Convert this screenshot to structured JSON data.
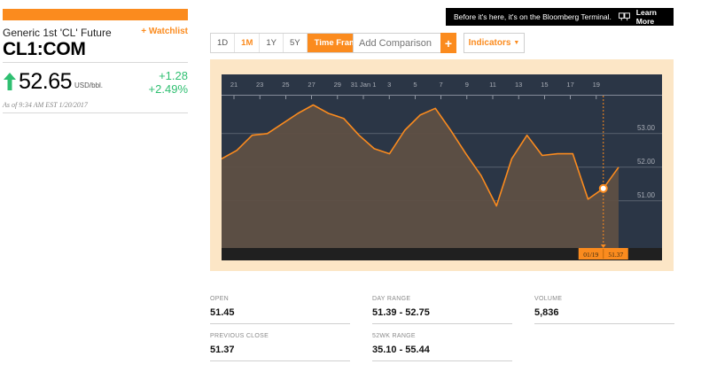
{
  "quote": {
    "name": "Generic 1st 'CL' Future",
    "watchlist_label": "+ Watchlist",
    "ticker": "CL1:COM",
    "price": "52.65",
    "unit": "USD/bbl.",
    "change": "+1.28",
    "change_pct": "+2.49%",
    "as_of": "As of 9:34 AM EST 1/20/2017",
    "direction_icon": "up-arrow-icon",
    "up_color": "#2fbf71",
    "accent_color": "#fb8b1e"
  },
  "ad": {
    "message": "Before it's here, it's on the Bloomberg Terminal.",
    "icon": "terminal-icon",
    "cta": "Learn More"
  },
  "toolbar": {
    "ranges": [
      "1D",
      "1M",
      "1Y",
      "5Y"
    ],
    "active_range": "1M",
    "time_frame_label": "Time Frame",
    "comparison_placeholder": "Add Comparison",
    "add_label": "+",
    "indicators_label": "Indicators"
  },
  "chart_data": {
    "type": "area",
    "x_ticks": [
      "21",
      "23",
      "25",
      "27",
      "29",
      "31 Jan 1",
      "3",
      "5",
      "7",
      "9",
      "11",
      "13",
      "15",
      "17",
      "19"
    ],
    "y_ticks": [
      "53.00",
      "52.00",
      "51.00"
    ],
    "ylim": [
      49.6,
      54.1
    ],
    "series": [
      {
        "values": [
          52.25,
          52.5,
          52.95,
          53.0,
          53.3,
          53.6,
          53.85,
          53.6,
          53.45,
          52.95,
          52.55,
          52.4,
          53.1,
          53.55,
          53.75,
          53.1,
          52.4,
          51.75,
          50.85,
          52.25,
          52.95,
          52.35,
          52.4,
          52.4,
          51.05,
          51.37,
          52.0
        ]
      }
    ],
    "crosshair": {
      "date_label": "01/19",
      "value_label": "51.37",
      "value": 51.37
    },
    "colors": {
      "background": "#2b3646",
      "line": "#fb8b1e",
      "area": "#5e5044",
      "grid": "#aab0bb",
      "axis_text": "#a8adb6"
    }
  },
  "stats": {
    "open": {
      "label": "OPEN",
      "value": "51.45"
    },
    "day_range": {
      "label": "DAY RANGE",
      "value": "51.39 - 52.75"
    },
    "volume": {
      "label": "VOLUME",
      "value": "5,836"
    },
    "prev_close": {
      "label": "PREVIOUS CLOSE",
      "value": "51.37"
    },
    "wk52": {
      "label": "52WK RANGE",
      "value": "35.10 - 55.44"
    }
  }
}
